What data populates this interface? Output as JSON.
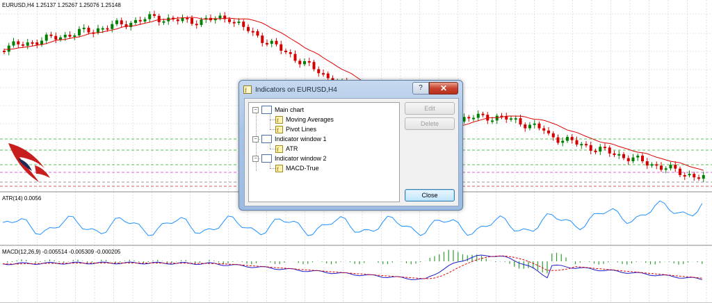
{
  "chart": {
    "symbol_header": "EURUSD,H4  1.25137 1.25267 1.25076 1.25148",
    "atr_label": "ATR(14) 0.0056",
    "macd_label": "MACD(12,26,9) -0.005514 -0.005309 -0.000205",
    "colors": {
      "bull": "#008000",
      "bear": "#d40000",
      "ma": "#e00000",
      "atr": "#1e90ff",
      "macd": "#1a1acc",
      "signal": "#e00000",
      "hist": "#2e9d2e",
      "grid": "#c8d0d8"
    }
  },
  "dialog": {
    "title": "Indicators on EURUSD,H4",
    "help_label": "?",
    "close_x": "✕",
    "tree": [
      {
        "label": "Main chart",
        "level": 0,
        "type": "window"
      },
      {
        "label": "Moving Averages",
        "level": 1,
        "type": "indicator"
      },
      {
        "label": "Pivot Lines",
        "level": 1,
        "type": "indicator"
      },
      {
        "label": "Indicator window 1",
        "level": 0,
        "type": "window"
      },
      {
        "label": "ATR",
        "level": 1,
        "type": "indicator"
      },
      {
        "label": "Indicator window 2",
        "level": 0,
        "type": "window"
      },
      {
        "label": "MACD-True",
        "level": 1,
        "type": "indicator"
      }
    ],
    "edit_label": "Edit",
    "delete_label": "Delete",
    "close_label": "Close"
  }
}
